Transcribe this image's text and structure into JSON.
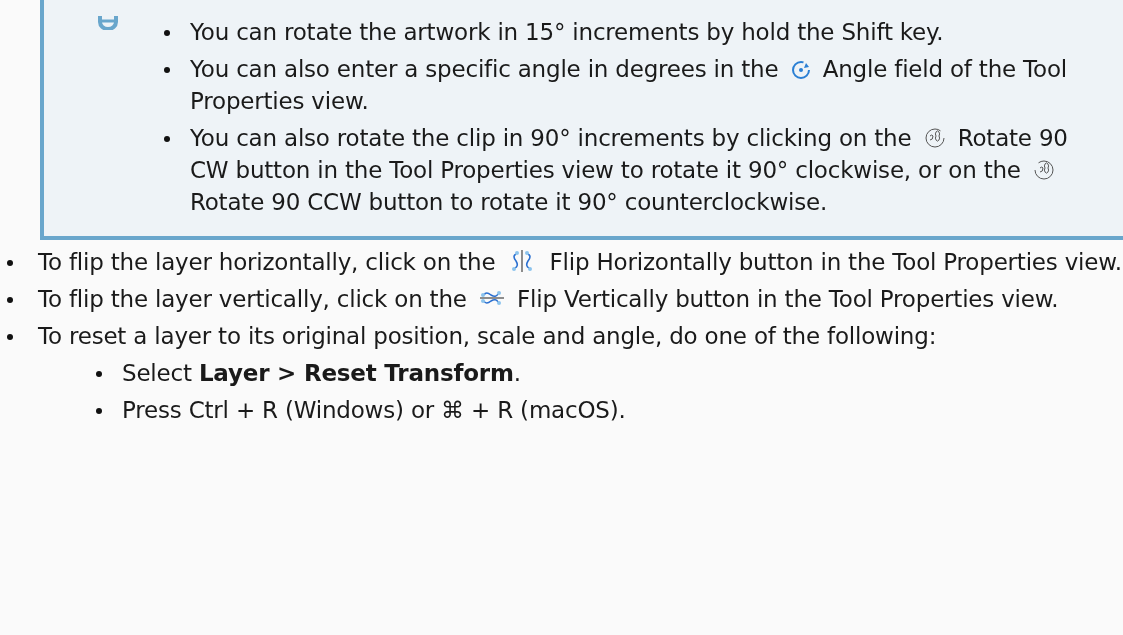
{
  "note": {
    "items": [
      {
        "parts": [
          {
            "kind": "text",
            "text": "You can rotate the artwork in 15° increments by hold the Shift key."
          }
        ]
      },
      {
        "parts": [
          {
            "kind": "text",
            "text": "You can also enter a specific angle in degrees in the"
          },
          {
            "kind": "angle"
          },
          {
            "kind": "text",
            "text": "Angle field of the Tool Properties view."
          }
        ]
      },
      {
        "parts": [
          {
            "kind": "text",
            "text": "You can also rotate the clip in 90° increments by clicking on the"
          },
          {
            "kind": "cw"
          },
          {
            "kind": "text",
            "text": "Rotate 90 CW button in the Tool Properties view to rotate it 90° clockwise, or on the"
          },
          {
            "kind": "ccw"
          },
          {
            "kind": "text",
            "text": "Rotate 90 CCW button to rotate it 90° counterclockwise."
          }
        ]
      }
    ]
  },
  "steps": [
    {
      "parts": [
        {
          "kind": "text",
          "text": "To flip the layer horizontally, click on the"
        },
        {
          "kind": "fliph"
        },
        {
          "kind": "text",
          "text": "Flip Horizontally button in the Tool Properties view."
        }
      ]
    },
    {
      "parts": [
        {
          "kind": "text",
          "text": "To flip the layer vertically, click on the"
        },
        {
          "kind": "flipv"
        },
        {
          "kind": "text",
          "text": "Flip Vertically button in the Tool Properties view."
        }
      ]
    },
    {
      "parts": [
        {
          "kind": "text",
          "text": "To reset a layer to its original position, scale and angle, do one of the following:"
        }
      ],
      "children": [
        {
          "parts": [
            {
              "kind": "text",
              "text": "Select **Layer > Reset Transform**."
            }
          ]
        },
        {
          "parts": [
            {
              "kind": "text",
              "text": "Press Ctrl + R (Windows) or ⌘ + R (macOS)."
            }
          ]
        }
      ]
    }
  ]
}
